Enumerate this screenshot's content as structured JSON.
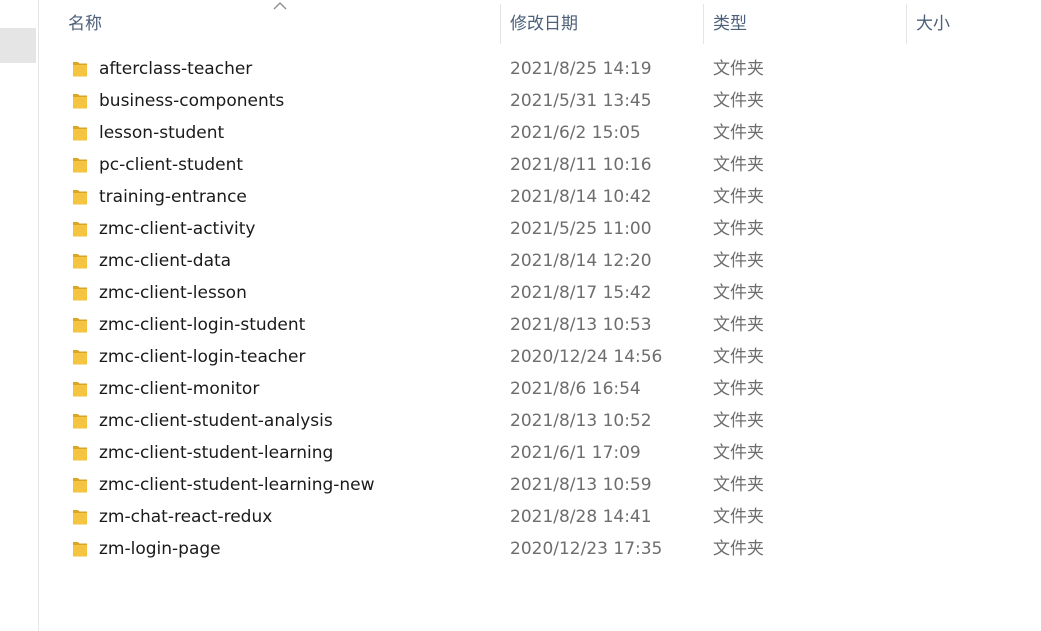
{
  "columns": {
    "name": "名称",
    "modified": "修改日期",
    "type": "类型",
    "size": "大小"
  },
  "sort": {
    "column": "name",
    "icon": "chevron-up-icon"
  },
  "colors": {
    "folder": "#f5c542",
    "folder_dark": "#dca52b",
    "header_text": "#4c607a",
    "secondary_text": "#6d6d6d"
  },
  "files": [
    {
      "name": "afterclass-teacher",
      "modified": "2021/8/25 14:19",
      "type": "文件夹"
    },
    {
      "name": "business-components",
      "modified": "2021/5/31 13:45",
      "type": "文件夹"
    },
    {
      "name": "lesson-student",
      "modified": "2021/6/2 15:05",
      "type": "文件夹"
    },
    {
      "name": "pc-client-student",
      "modified": "2021/8/11 10:16",
      "type": "文件夹"
    },
    {
      "name": "training-entrance",
      "modified": "2021/8/14 10:42",
      "type": "文件夹"
    },
    {
      "name": "zmc-client-activity",
      "modified": "2021/5/25 11:00",
      "type": "文件夹"
    },
    {
      "name": "zmc-client-data",
      "modified": "2021/8/14 12:20",
      "type": "文件夹"
    },
    {
      "name": "zmc-client-lesson",
      "modified": "2021/8/17 15:42",
      "type": "文件夹"
    },
    {
      "name": "zmc-client-login-student",
      "modified": "2021/8/13 10:53",
      "type": "文件夹"
    },
    {
      "name": "zmc-client-login-teacher",
      "modified": "2020/12/24 14:56",
      "type": "文件夹"
    },
    {
      "name": "zmc-client-monitor",
      "modified": "2021/8/6 16:54",
      "type": "文件夹"
    },
    {
      "name": "zmc-client-student-analysis",
      "modified": "2021/8/13 10:52",
      "type": "文件夹"
    },
    {
      "name": "zmc-client-student-learning",
      "modified": "2021/6/1 17:09",
      "type": "文件夹"
    },
    {
      "name": "zmc-client-student-learning-new",
      "modified": "2021/8/13 10:59",
      "type": "文件夹"
    },
    {
      "name": "zm-chat-react-redux",
      "modified": "2021/8/28 14:41",
      "type": "文件夹"
    },
    {
      "name": "zm-login-page",
      "modified": "2020/12/23 17:35",
      "type": "文件夹"
    }
  ]
}
